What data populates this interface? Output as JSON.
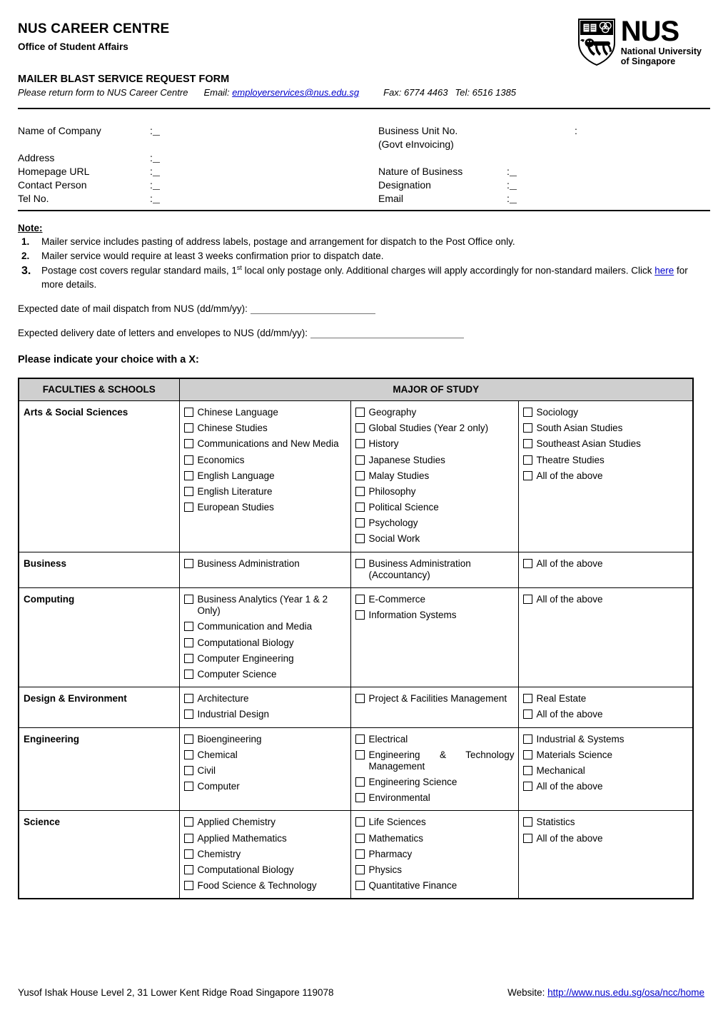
{
  "header": {
    "org_title": "NUS CAREER CENTRE",
    "org_sub": "Office of Student Affairs",
    "logo": {
      "wordmark": "NUS",
      "line1": "National University",
      "line2": "of Singapore",
      "crest_icon": "nus-crest-lion-icon"
    },
    "form_title": "MAILER BLAST SERVICE REQUEST FORM",
    "return_prefix": "Please return form to NUS Career Centre",
    "email_label": "Email:",
    "email": "employerservices@nus.edu.sg",
    "fax": "Fax: 6774 4463",
    "tel": "Tel: 6516 1385"
  },
  "fields": {
    "name_of_company": "Name of Company",
    "address": "Address",
    "homepage_url": "Homepage URL",
    "contact_person": "Contact Person",
    "tel_no": "Tel No.",
    "business_unit_no": "Business Unit No.",
    "business_unit_sub": "(Govt eInvoicing)",
    "nature_of_business": "Nature of Business",
    "designation": "Designation",
    "email": "Email",
    "colon": ":",
    "values": {
      "name_of_company": "",
      "address": "",
      "homepage_url": "",
      "contact_person": "",
      "tel_no": "",
      "business_unit_no": "",
      "nature_of_business": "",
      "designation": "",
      "email": ""
    }
  },
  "notes": {
    "heading": "Note:",
    "items": [
      {
        "num": "1.",
        "text": "Mailer service includes pasting of address labels, postage and arrangement for dispatch to the Post Office only."
      },
      {
        "num": "2.",
        "text": "Mailer service would require at least 3 weeks confirmation prior to dispatch date."
      },
      {
        "num": "3.",
        "text_a": "Postage cost covers regular standard mails, 1",
        "sup": "st",
        "text_b": " local only postage only. Additional charges will apply accordingly for non-standard mailers. Click ",
        "link": "here",
        "text_c": " for more details."
      }
    ]
  },
  "expected": {
    "dispatch_label": "Expected date of mail dispatch from NUS (dd/mm/yy):",
    "dispatch_value": "",
    "delivery_label": "Expected delivery date of letters and envelopes to NUS (dd/mm/yy):",
    "delivery_value": ""
  },
  "instruction": "Please indicate your choice with a X:",
  "table": {
    "col_headers": [
      "FACULTIES & SCHOOLS",
      "MAJOR OF STUDY"
    ],
    "rows": [
      {
        "faculty": "Arts & Social Sciences",
        "col1": [
          "Chinese Language",
          "Chinese Studies",
          "Communications and New Media",
          "Economics",
          "English Language",
          "English Literature",
          "European Studies"
        ],
        "col2": [
          "Geography",
          "Global Studies (Year 2 only)",
          "History",
          "Japanese Studies",
          "Malay Studies",
          "Philosophy",
          "Political Science",
          "Psychology",
          "Social Work"
        ],
        "col3": [
          "Sociology",
          "South Asian Studies",
          "Southeast Asian Studies",
          "Theatre Studies",
          "All of the above"
        ]
      },
      {
        "faculty": "Business",
        "col1": [
          "Business Administration"
        ],
        "col2": [
          "Business Administration (Accountancy)"
        ],
        "col3": [
          "All of the above"
        ]
      },
      {
        "faculty": "Computing",
        "col1": [
          "Business Analytics (Year 1 & 2 Only)",
          "Communication and Media",
          "Computational Biology",
          "Computer Engineering",
          "Computer Science"
        ],
        "col2": [
          "E-Commerce",
          "Information Systems"
        ],
        "col3": [
          "All of the above"
        ]
      },
      {
        "faculty": "Design & Environment",
        "col1": [
          "Architecture",
          "Industrial Design"
        ],
        "col2": [
          "Project & Facilities Management"
        ],
        "col3": [
          "Real Estate",
          "All of the above"
        ]
      },
      {
        "faculty": "Engineering",
        "col1": [
          "Bioengineering",
          "Chemical",
          "Civil",
          "Computer"
        ],
        "col2": [
          "Electrical",
          "Engineering & Technology Management",
          "Engineering Science",
          "Environmental"
        ],
        "col3": [
          "Industrial & Systems",
          "Materials Science",
          "Mechanical",
          "All of the above"
        ]
      },
      {
        "faculty": "Science",
        "col1": [
          "Applied Chemistry",
          "Applied Mathematics",
          "Chemistry",
          "Computational Biology",
          "Food Science & Technology"
        ],
        "col2": [
          "Life Sciences",
          "Mathematics",
          "Pharmacy",
          "Physics",
          "Quantitative Finance"
        ],
        "col3": [
          "Statistics",
          "All of the above"
        ]
      }
    ]
  },
  "footer": {
    "address": "Yusof Ishak House Level 2, 31 Lower Kent Ridge Road Singapore 119078",
    "website_label": "Website:",
    "website_url": "http://www.nus.edu.sg/osa/ncc/home"
  },
  "colors": {
    "header_fill": "#cfcfcf",
    "link": "#0000cc",
    "border": "#000000"
  }
}
